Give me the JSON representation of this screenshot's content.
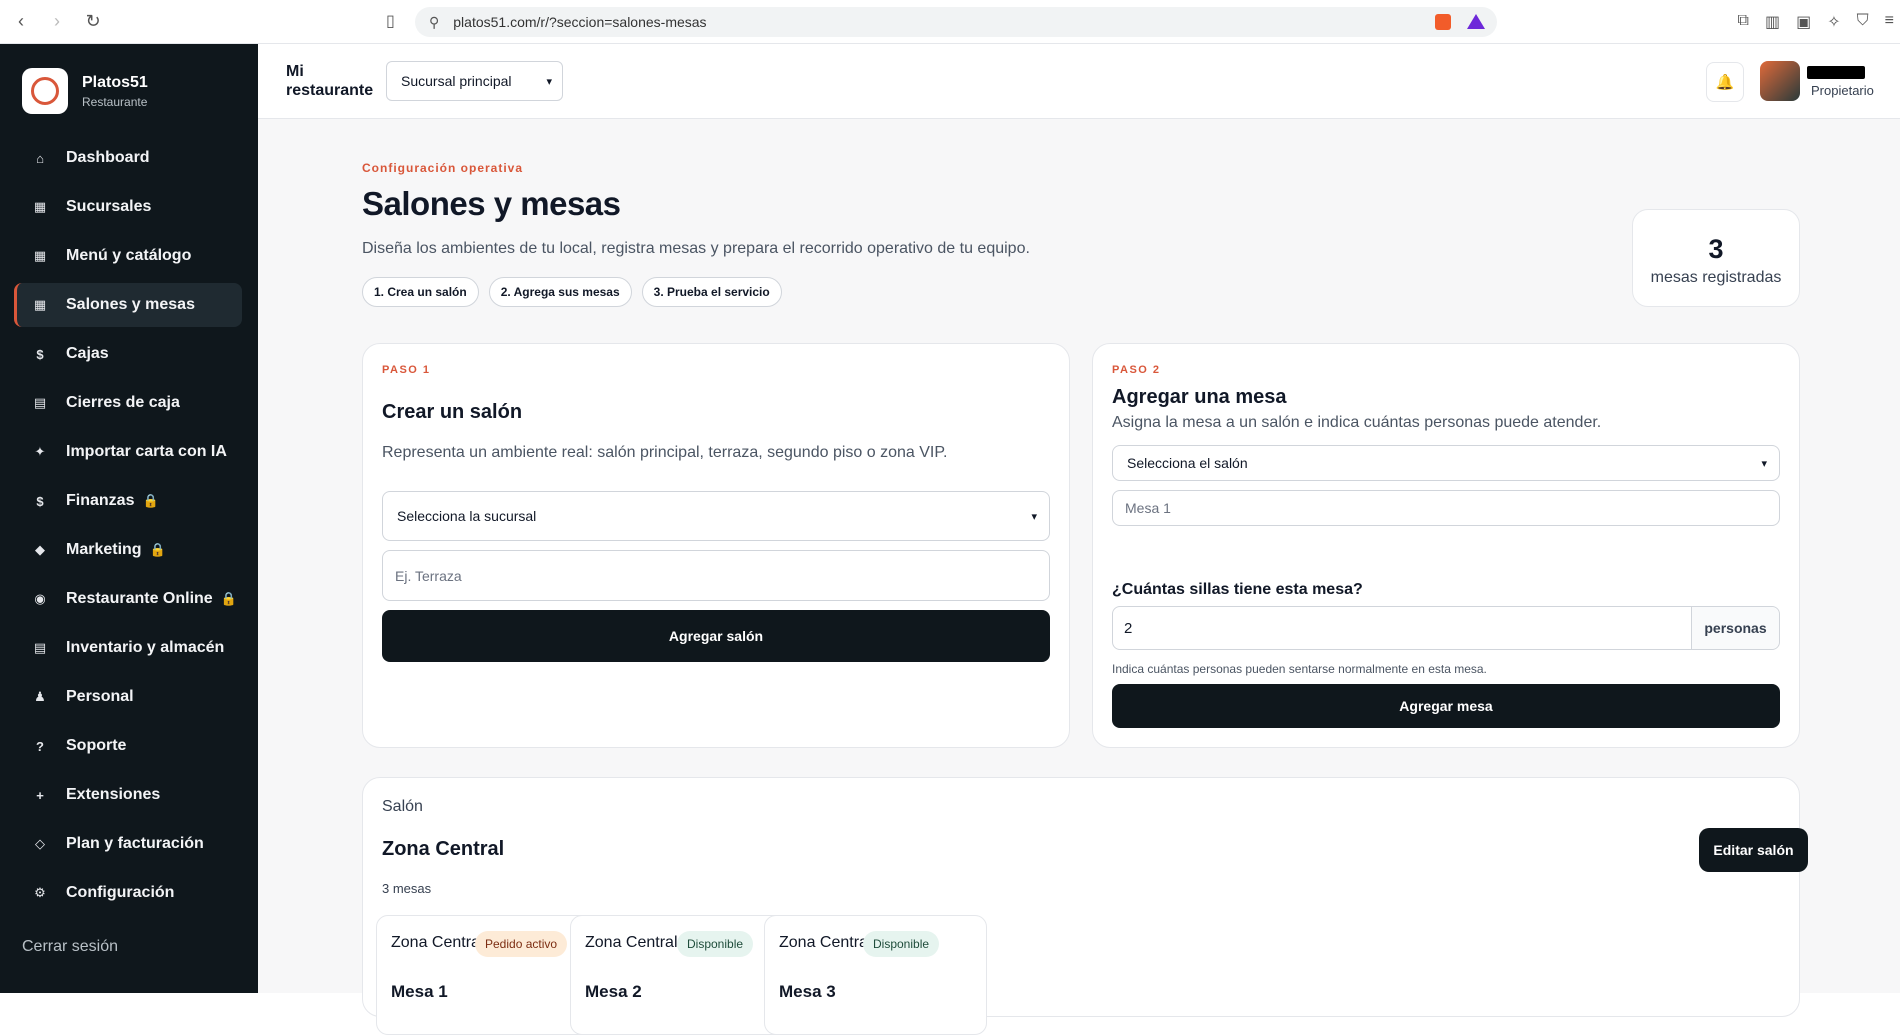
{
  "browser": {
    "url": "platos51.com/r/?seccion=salones-mesas"
  },
  "sidebar": {
    "brand_name": "Platos51",
    "brand_sub": "Restaurante",
    "items": [
      {
        "label": "Dashboard",
        "icon": "⌂",
        "locked": false
      },
      {
        "label": "Sucursales",
        "icon": "▦",
        "locked": false
      },
      {
        "label": "Menú y catálogo",
        "icon": "▦",
        "locked": false
      },
      {
        "label": "Salones y mesas",
        "icon": "▦",
        "locked": false,
        "active": true
      },
      {
        "label": "Cajas",
        "icon": "$",
        "locked": false
      },
      {
        "label": "Cierres de caja",
        "icon": "▤",
        "locked": false
      },
      {
        "label": "Importar carta con IA",
        "icon": "✦",
        "locked": false
      },
      {
        "label": "Finanzas",
        "icon": "$",
        "locked": true
      },
      {
        "label": "Marketing",
        "icon": "◆",
        "locked": true
      },
      {
        "label": "Restaurante Online",
        "icon": "◉",
        "locked": true
      },
      {
        "label": "Inventario y almacén",
        "icon": "▤",
        "locked": false
      },
      {
        "label": "Personal",
        "icon": "♟",
        "locked": false
      },
      {
        "label": "Soporte",
        "icon": "?",
        "locked": false
      },
      {
        "label": "Extensiones",
        "icon": "+",
        "locked": false
      },
      {
        "label": "Plan y facturación",
        "icon": "◇",
        "locked": false
      },
      {
        "label": "Configuración",
        "icon": "⚙",
        "locked": false
      }
    ],
    "logout": "Cerrar sesión"
  },
  "header": {
    "mi_restaurante": "Mi restaurante",
    "branch_selected": "Sucursal principal",
    "user_role": "Propietario"
  },
  "page": {
    "eyebrow": "Configuración operativa",
    "title": "Salones y mesas",
    "description": "Diseña los ambientes de tu local, registra mesas y prepara el recorrido operativo de tu equipo.",
    "steps": [
      "1. Crea un salón",
      "2. Agrega sus mesas",
      "3. Prueba el servicio"
    ],
    "counter_value": "3",
    "counter_label": "mesas registradas"
  },
  "card_salon": {
    "step": "PASO 1",
    "title": "Crear un salón",
    "description": "Representa un ambiente real: salón principal, terraza, segundo piso o zona VIP.",
    "branch_select": "Selecciona la sucursal",
    "name_placeholder": "Ej. Terraza",
    "button": "Agregar salón"
  },
  "card_mesa": {
    "step": "PASO 2",
    "title": "Agregar una mesa",
    "description": "Asigna la mesa a un salón e indica cuántas personas puede atender.",
    "salon_select": "Selecciona el salón",
    "name_placeholder": "Mesa 1",
    "chairs_label": "¿Cuántas sillas tiene esta mesa?",
    "chairs_value": "2",
    "chairs_unit": "personas",
    "hint": "Indica cuántas personas pueden sentarse normalmente en esta mesa.",
    "button": "Agregar mesa"
  },
  "salon": {
    "label": "Salón",
    "name": "Zona Central",
    "mesas_count": "3 mesas",
    "edit_button": "Editar salón",
    "mesas": [
      {
        "zone": "Zona Central",
        "status": "Pedido activo",
        "status_type": "warn",
        "name": "Mesa 1"
      },
      {
        "zone": "Zona Central",
        "status": "Disponible",
        "status_type": "ok",
        "name": "Mesa 2"
      },
      {
        "zone": "Zona Central",
        "status": "Disponible",
        "status_type": "ok",
        "name": "Mesa 3"
      }
    ]
  },
  "colors": {
    "accent": "#d9573a",
    "sidebar_bg": "#0f171c"
  }
}
